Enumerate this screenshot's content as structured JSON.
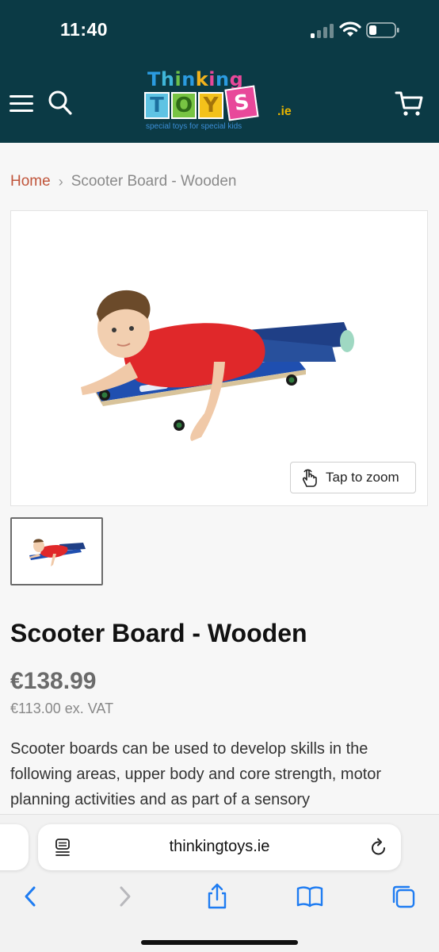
{
  "status_bar": {
    "time": "11:40"
  },
  "header": {
    "logo": {
      "word_thinking": "Thinking",
      "word_toys": "TOYS",
      "suffix": ".ie",
      "tagline": "special toys for special kids"
    },
    "icons": {
      "menu": "hamburger-menu-icon",
      "search": "search-icon",
      "cart": "cart-icon"
    }
  },
  "breadcrumb": {
    "home": "Home",
    "separator": "›",
    "current": "Scooter Board - Wooden"
  },
  "product": {
    "zoom_label": "Tap to zoom",
    "title": "Scooter Board - Wooden",
    "price": "€138.99",
    "price_ex_vat": "€113.00 ex. VAT",
    "description": "Scooter boards can be used to develop skills in the following areas, upper body and core strength, motor planning activities and as part of a sensory"
  },
  "browser": {
    "url": "thinkingtoys.ie"
  },
  "colors": {
    "header_bg": "#0b3a45",
    "breadcrumb_link": "#c0553b",
    "safari_blue": "#1e7cf2"
  }
}
